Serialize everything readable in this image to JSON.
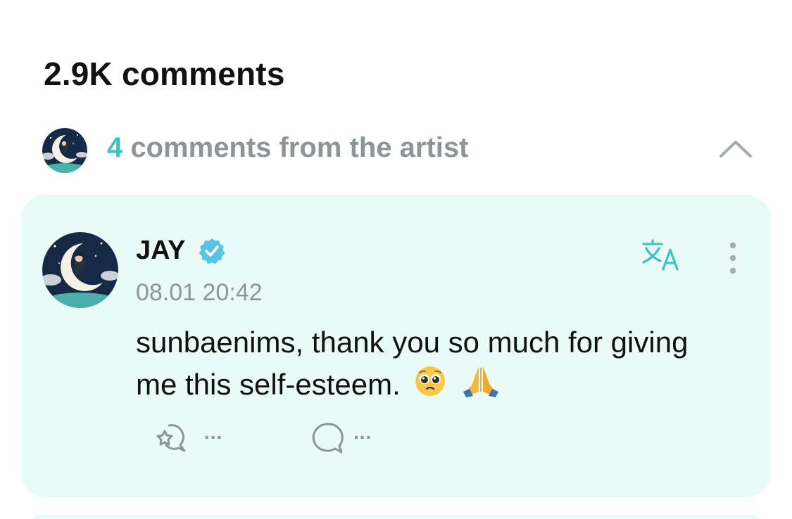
{
  "comments_header": {
    "title": "2.9K comments"
  },
  "artist_comments": {
    "count": "4",
    "label": "comments from the artist",
    "toggle_icon": "chevron-up-icon"
  },
  "comment": {
    "author": "JAY",
    "verified_icon": "verified-badge-icon",
    "timestamp": "08.01 20:42",
    "text": "sunbaenims, thank you so much for giving me this self-esteem.",
    "emojis": [
      "pleading-face",
      "folded-hands"
    ],
    "translate_icon": "translate-icon",
    "more_icon": "more-vertical-icon",
    "like_icon": "cheer-icon",
    "like_count": "...",
    "reply_icon": "reply-bubble-icon",
    "reply_count": "..."
  },
  "colors": {
    "accent": "#3cc3c0",
    "card_bg": "#e9faf7",
    "muted_text": "#8f9497",
    "primary_text": "#111111"
  }
}
